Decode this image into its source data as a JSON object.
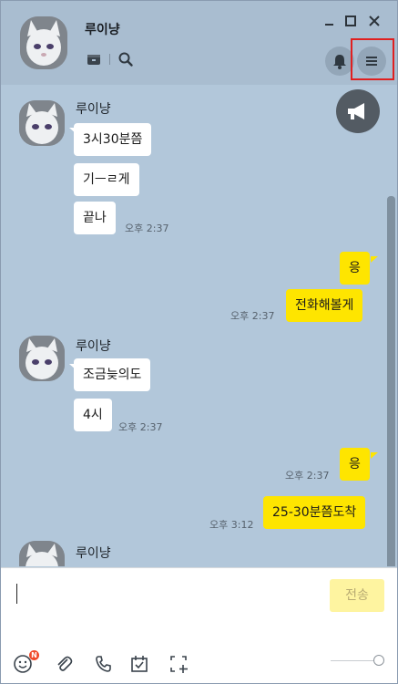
{
  "header": {
    "contact_name": "루이냥"
  },
  "colors": {
    "chat_background": "#b2c7da",
    "my_bubble": "#fee500",
    "their_bubble": "#ffffff",
    "highlight": "#e02020"
  },
  "messages": [
    {
      "sender": "루이냥",
      "text": "3시30분쯤"
    },
    {
      "text": "기ㅡㄹ게"
    },
    {
      "text": "끝나",
      "time": "오후 2:37"
    },
    {
      "text": "응"
    },
    {
      "text": "전화해볼게",
      "time": "오후 2:37"
    },
    {
      "sender": "루이냥",
      "text": "조금늦의도"
    },
    {
      "text": "4시",
      "time": "오후 2:37"
    },
    {
      "text": "응",
      "time": "오후 2:37"
    },
    {
      "text": "25-30분쯤도착",
      "time": "오후 3:12"
    },
    {
      "sender": "루이냥"
    }
  ],
  "input": {
    "send_label": "전송",
    "emoji_badge": "N"
  }
}
